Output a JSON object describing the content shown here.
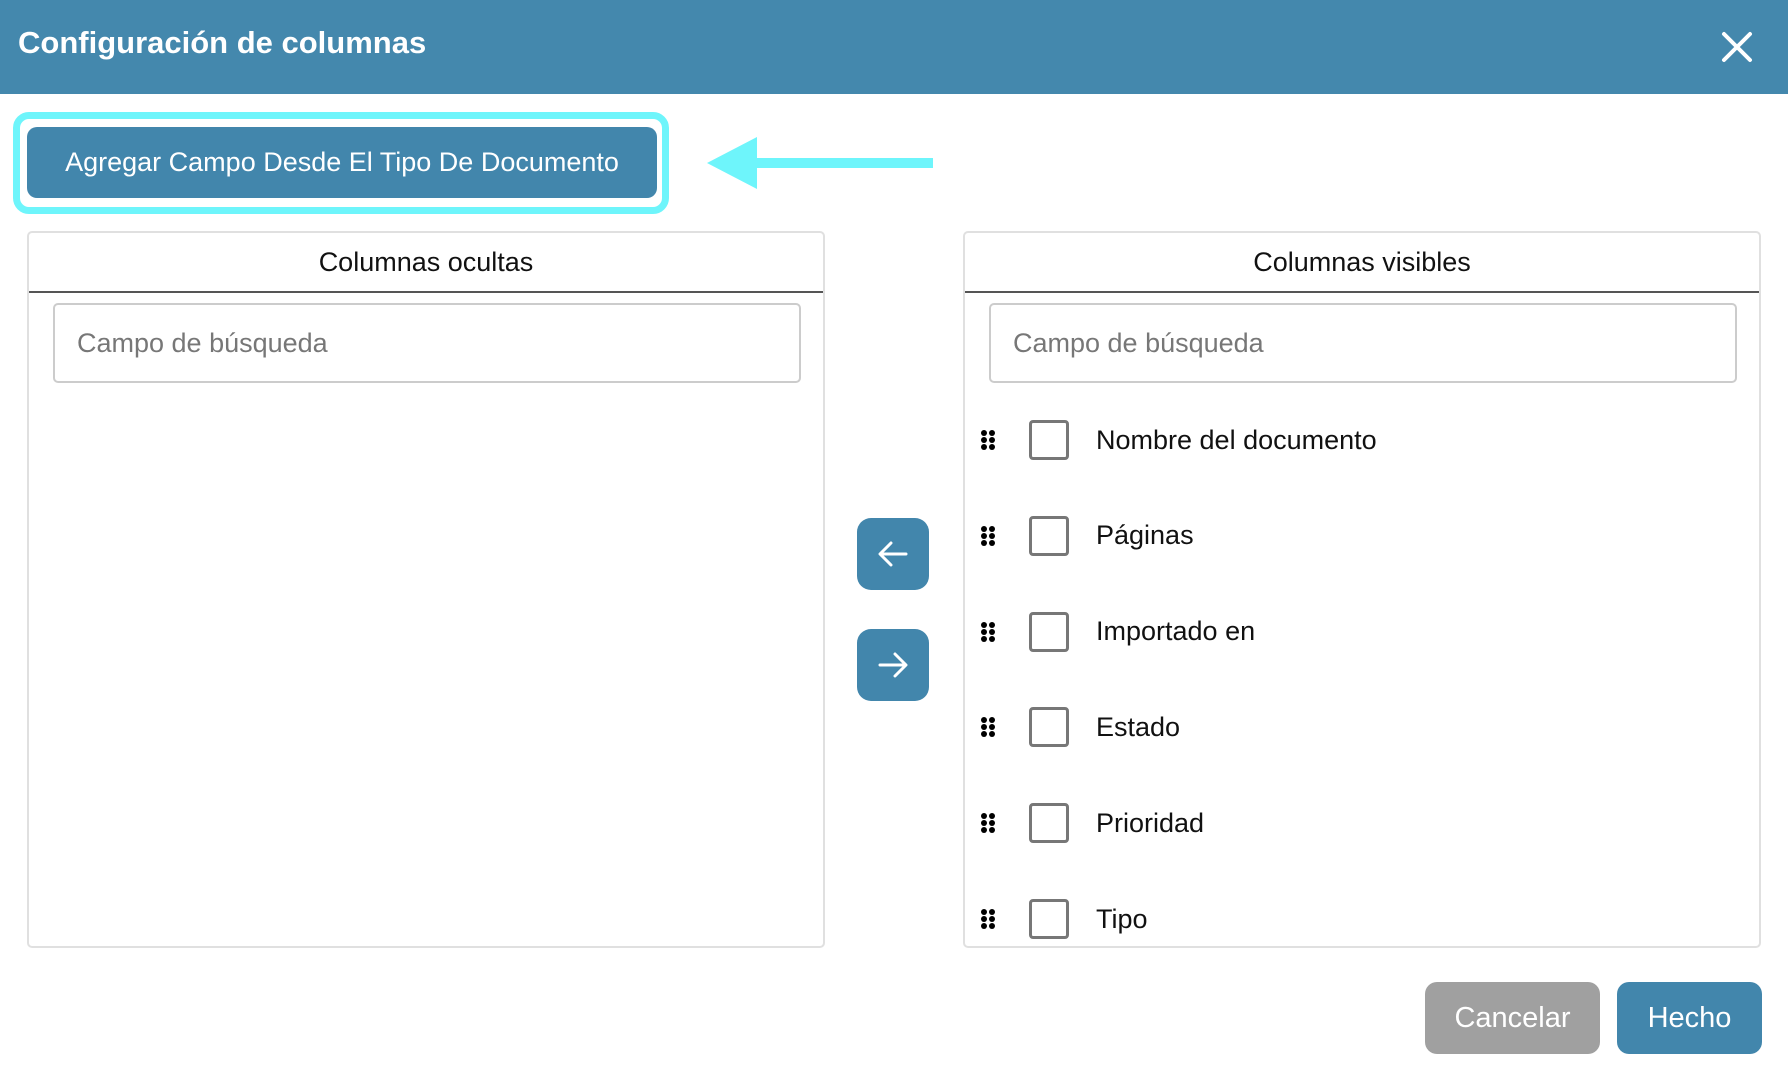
{
  "dialog": {
    "title": "Configuración de columnas",
    "close_icon": "close-icon"
  },
  "add_field_button": "Agregar Campo Desde El Tipo De Documento",
  "hidden_columns": {
    "title": "Columnas ocultas",
    "search_placeholder": "Campo de búsqueda",
    "items": []
  },
  "visible_columns": {
    "title": "Columnas visibles",
    "search_placeholder": "Campo de búsqueda",
    "items": [
      {
        "label": "Nombre del documento"
      },
      {
        "label": "Páginas"
      },
      {
        "label": "Importado en"
      },
      {
        "label": "Estado"
      },
      {
        "label": "Prioridad"
      },
      {
        "label": "Tipo"
      }
    ]
  },
  "footer": {
    "cancel": "Cancelar",
    "done": "Hecho"
  },
  "colors": {
    "header": "#4488ad",
    "primary": "#4286ac",
    "highlight": "#6ef5fb",
    "cancel": "#a0a0a0"
  }
}
